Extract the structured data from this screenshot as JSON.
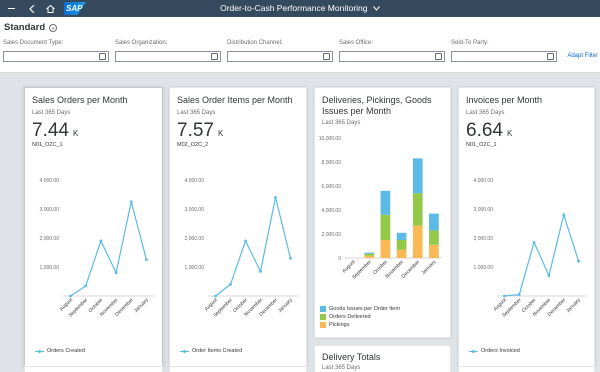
{
  "shell": {
    "logo": "SAP",
    "title": "Order-to-Cash Performance Monitoring",
    "title_chevron": "chevron-down-icon"
  },
  "header": {
    "variant": "Standard",
    "filters": [
      {
        "label": "Sales Document Type:",
        "value": ""
      },
      {
        "label": "Sales Organization:",
        "value": ""
      },
      {
        "label": "Distribution Channel:",
        "value": ""
      },
      {
        "label": "Sales Office:",
        "value": ""
      },
      {
        "label": "Sold-To Party:",
        "value": ""
      }
    ],
    "adapt": "Adapt Filter"
  },
  "cards": [
    {
      "title": "Sales Orders per Month",
      "subtitle": "Last 365 Days",
      "kpi": "7.44",
      "unit": "K",
      "id": "N01_O2C_1",
      "legend": "Orders Created"
    },
    {
      "title": "Sales Order Items per Month",
      "subtitle": "Last 365 Days",
      "kpi": "7.57",
      "unit": "K",
      "id": "M02_O2C_2",
      "legend": "Order Items Created"
    },
    {
      "title": "Deliveries, Pickings, Goods Issues per Month",
      "subtitle": "Last 365 Days"
    },
    {
      "title": "Invoices per Month",
      "subtitle": "Last 365 Days",
      "kpi": "6.64",
      "unit": "K",
      "id": "N01_O2C_1",
      "legend": "Orders Invoiced"
    },
    {
      "title": "Delivery Totals",
      "subtitle": "Last 365 Days"
    }
  ],
  "chart_data": [
    {
      "type": "line",
      "categories": [
        "August",
        "September",
        "October",
        "November",
        "December",
        "January"
      ],
      "series": [
        {
          "name": "Orders Created",
          "values": [
            0,
            350,
            1900,
            800,
            3250,
            1250
          ]
        }
      ],
      "yticks": [
        "1,000.00",
        "2,000.00",
        "3,000.00",
        "4,000.00"
      ],
      "ylim": [
        0,
        4000
      ],
      "color": "#5cbae6"
    },
    {
      "type": "line",
      "categories": [
        "August",
        "September",
        "October",
        "November",
        "December",
        "January"
      ],
      "series": [
        {
          "name": "Order Items Created",
          "values": [
            0,
            400,
            1900,
            850,
            3400,
            1300
          ]
        }
      ],
      "yticks": [
        "1,000.00",
        "2,000.00",
        "3,000.00",
        "4,000.00"
      ],
      "ylim": [
        0,
        4000
      ],
      "color": "#5cbae6"
    },
    {
      "type": "bar",
      "stacked": true,
      "categories": [
        "August",
        "September",
        "October",
        "November",
        "December",
        "January"
      ],
      "series": [
        {
          "name": "Pickings",
          "values": [
            0,
            200,
            1500,
            700,
            2700,
            1100
          ],
          "color": "#fab955"
        },
        {
          "name": "Orders Delivered",
          "values": [
            0,
            150,
            2100,
            800,
            2700,
            1200
          ],
          "color": "#93c849"
        },
        {
          "name": "Goods Issues per Order Item",
          "values": [
            0,
            100,
            2000,
            600,
            2900,
            1400
          ],
          "color": "#5cbae6"
        }
      ],
      "legend_order": [
        "Goods Issues per Order Item",
        "Orders Delivered",
        "Pickings"
      ],
      "yticks": [
        "0",
        "2,000.00",
        "4,000.00",
        "6,000.00",
        "8,000.00",
        "10,000.00"
      ],
      "ylim": [
        0,
        10000
      ]
    },
    {
      "type": "line",
      "categories": [
        "August",
        "September",
        "October",
        "November",
        "December",
        "January"
      ],
      "series": [
        {
          "name": "Orders Invoiced",
          "values": [
            0,
            50,
            1850,
            700,
            2800,
            1200
          ]
        }
      ],
      "yticks": [
        "1,000.00",
        "2,000.00",
        "3,000.00",
        "4,000.00"
      ],
      "ylim": [
        0,
        4000
      ],
      "color": "#5cbae6"
    }
  ]
}
